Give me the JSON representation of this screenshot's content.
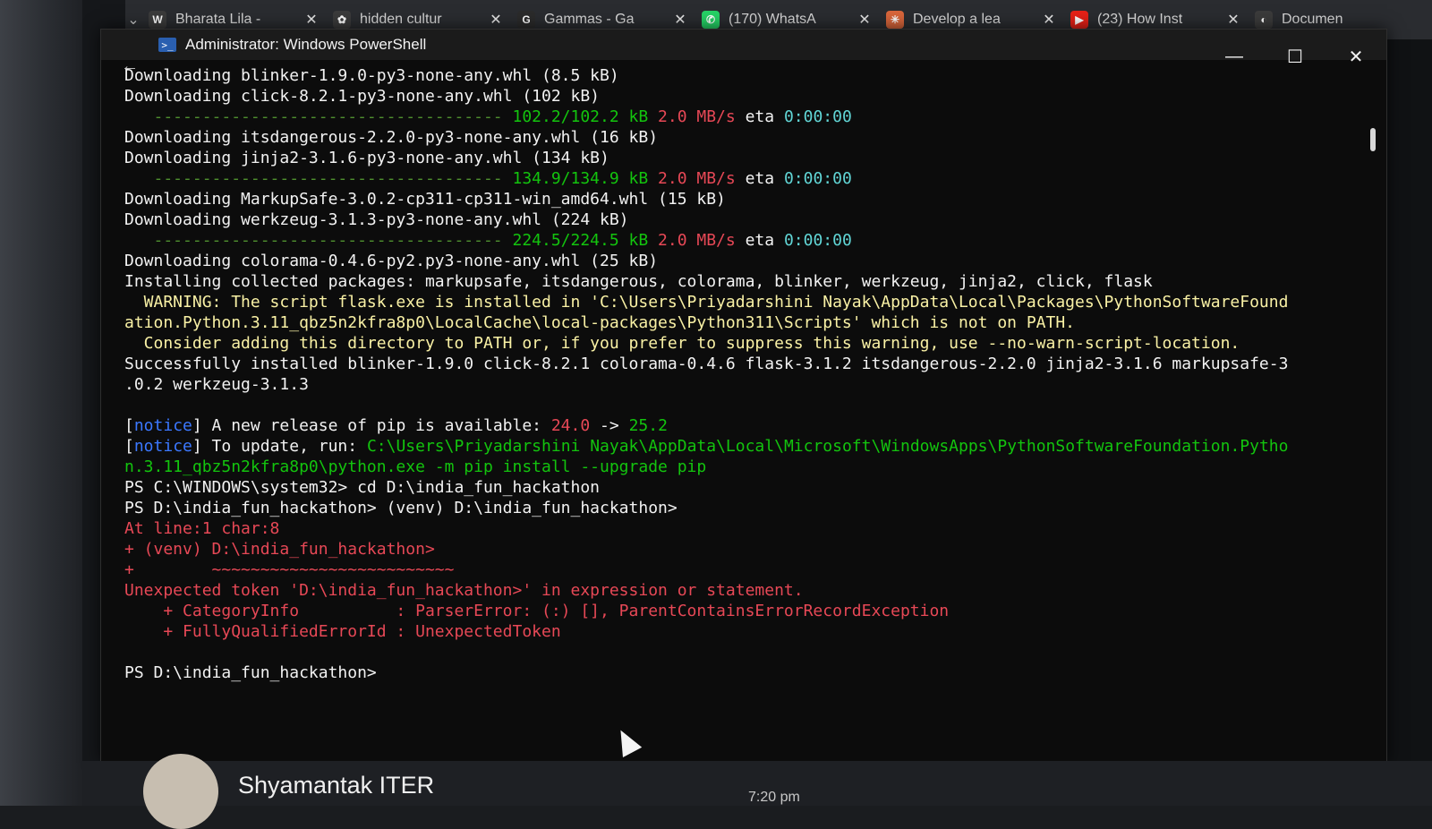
{
  "browser": {
    "tabs": [
      {
        "label": "Bharata Lila -",
        "favicon": "W",
        "favicon_color": "#3b3b3b"
      },
      {
        "label": "hidden cultur",
        "favicon": "✿",
        "favicon_color": "#3b3b3b"
      },
      {
        "label": "Gammas - Ga",
        "favicon": "G",
        "favicon_color": "#2b2b2b"
      },
      {
        "label": "(170) WhatsA",
        "favicon": "✆",
        "favicon_color": "#25d366"
      },
      {
        "label": "Develop a lea",
        "favicon": "✳",
        "favicon_color": "#d9663b"
      },
      {
        "label": "(23) How Inst",
        "favicon": "▶",
        "favicon_color": "#e62117"
      },
      {
        "label": "Documen",
        "favicon": "◐",
        "favicon_color": "#3b3b3b"
      }
    ],
    "tab_close_glyph": "✕"
  },
  "window": {
    "title": "Administrator: Windows PowerShell",
    "controls": {
      "minimize": "—",
      "maximize": "☐",
      "close": "✕"
    }
  },
  "terminal": {
    "lines": [
      [
        {
          "t": "Downloading blinker-1.9.0-py3-none-any.whl (8.5 kB)",
          "c": "c-white"
        }
      ],
      [
        {
          "t": "Downloading click-8.2.1-py3-none-any.whl (102 kB)",
          "c": "c-white"
        }
      ],
      [
        {
          "t": "   ------------------------------------ ",
          "c": "bar"
        },
        {
          "t": "102.2/102.2 kB",
          "c": "c-green"
        },
        {
          "t": " 2.0 MB/s",
          "c": "c-red"
        },
        {
          "t": " eta ",
          "c": "c-white"
        },
        {
          "t": "0:00:00",
          "c": "c-cyan"
        }
      ],
      [
        {
          "t": "Downloading itsdangerous-2.2.0-py3-none-any.whl (16 kB)",
          "c": "c-white"
        }
      ],
      [
        {
          "t": "Downloading jinja2-3.1.6-py3-none-any.whl (134 kB)",
          "c": "c-white"
        }
      ],
      [
        {
          "t": "   ------------------------------------ ",
          "c": "bar"
        },
        {
          "t": "134.9/134.9 kB",
          "c": "c-green"
        },
        {
          "t": " 2.0 MB/s",
          "c": "c-red"
        },
        {
          "t": " eta ",
          "c": "c-white"
        },
        {
          "t": "0:00:00",
          "c": "c-cyan"
        }
      ],
      [
        {
          "t": "Downloading MarkupSafe-3.0.2-cp311-cp311-win_amd64.whl (15 kB)",
          "c": "c-white"
        }
      ],
      [
        {
          "t": "Downloading werkzeug-3.1.3-py3-none-any.whl (224 kB)",
          "c": "c-white"
        }
      ],
      [
        {
          "t": "   ------------------------------------ ",
          "c": "bar"
        },
        {
          "t": "224.5/224.5 kB",
          "c": "c-green"
        },
        {
          "t": " 2.0 MB/s",
          "c": "c-red"
        },
        {
          "t": " eta ",
          "c": "c-white"
        },
        {
          "t": "0:00:00",
          "c": "c-cyan"
        }
      ],
      [
        {
          "t": "Downloading colorama-0.4.6-py2.py3-none-any.whl (25 kB)",
          "c": "c-white"
        }
      ],
      [
        {
          "t": "Installing collected packages: markupsafe, itsdangerous, colorama, blinker, werkzeug, jinja2, click, flask",
          "c": "c-white"
        }
      ],
      [
        {
          "t": "  WARNING: The script flask.exe is installed in 'C:\\Users\\Priyadarshini Nayak\\AppData\\Local\\Packages\\PythonSoftwareFound",
          "c": "c-yellow"
        }
      ],
      [
        {
          "t": "ation.Python.3.11_qbz5n2kfra8p0\\LocalCache\\local-packages\\Python311\\Scripts' which is not on PATH.",
          "c": "c-yellow"
        }
      ],
      [
        {
          "t": "  Consider adding this directory to PATH or, if you prefer to suppress this warning, use --no-warn-script-location.",
          "c": "c-yellow"
        }
      ],
      [
        {
          "t": "Successfully installed blinker-1.9.0 click-8.2.1 colorama-0.4.6 flask-3.1.2 itsdangerous-2.2.0 jinja2-3.1.6 markupsafe-3",
          "c": "c-white"
        }
      ],
      [
        {
          "t": ".0.2 werkzeug-3.1.3",
          "c": "c-white"
        }
      ],
      [
        {
          "t": "",
          "c": "c-white"
        }
      ],
      [
        {
          "t": "[",
          "c": "c-white"
        },
        {
          "t": "notice",
          "c": "c-blue"
        },
        {
          "t": "] A new release of pip is available: ",
          "c": "c-white"
        },
        {
          "t": "24.0",
          "c": "c-red"
        },
        {
          "t": " -> ",
          "c": "c-white"
        },
        {
          "t": "25.2",
          "c": "c-green"
        }
      ],
      [
        {
          "t": "[",
          "c": "c-white"
        },
        {
          "t": "notice",
          "c": "c-blue"
        },
        {
          "t": "] To update, run: ",
          "c": "c-white"
        },
        {
          "t": "C:\\Users\\Priyadarshini Nayak\\AppData\\Local\\Microsoft\\WindowsApps\\PythonSoftwareFoundation.Pytho",
          "c": "c-green"
        }
      ],
      [
        {
          "t": "n.3.11_qbz5n2kfra8p0\\python.exe -m pip install --upgrade pip",
          "c": "c-green"
        }
      ],
      [
        {
          "t": "PS C:\\WINDOWS\\system32> cd D:\\india_fun_hackathon",
          "c": "c-white"
        }
      ],
      [
        {
          "t": "PS D:\\india_fun_hackathon> (venv) D:\\india_fun_hackathon>",
          "c": "c-white"
        }
      ],
      [
        {
          "t": "At line:1 char:8",
          "c": "c-red"
        }
      ],
      [
        {
          "t": "+ (venv) D:\\india_fun_hackathon>",
          "c": "c-red"
        }
      ],
      [
        {
          "t": "+        ~~~~~~~~~~~~~~~~~~~~~~~~~",
          "c": "c-red"
        }
      ],
      [
        {
          "t": "Unexpected token 'D:\\india_fun_hackathon>' in expression or statement.",
          "c": "c-red"
        }
      ],
      [
        {
          "t": "    + CategoryInfo          : ParserError: (:) [], ParentContainsErrorRecordException",
          "c": "c-red"
        }
      ],
      [
        {
          "t": "    + FullyQualifiedErrorId : UnexpectedToken",
          "c": "c-red"
        }
      ],
      [
        {
          "t": "",
          "c": "c-white"
        }
      ],
      [
        {
          "t": "PS D:\\india_fun_hackathon>",
          "c": "c-white"
        }
      ]
    ]
  },
  "chat": {
    "contact_name": "Shyamantak ITER",
    "time": "7:20 pm"
  }
}
